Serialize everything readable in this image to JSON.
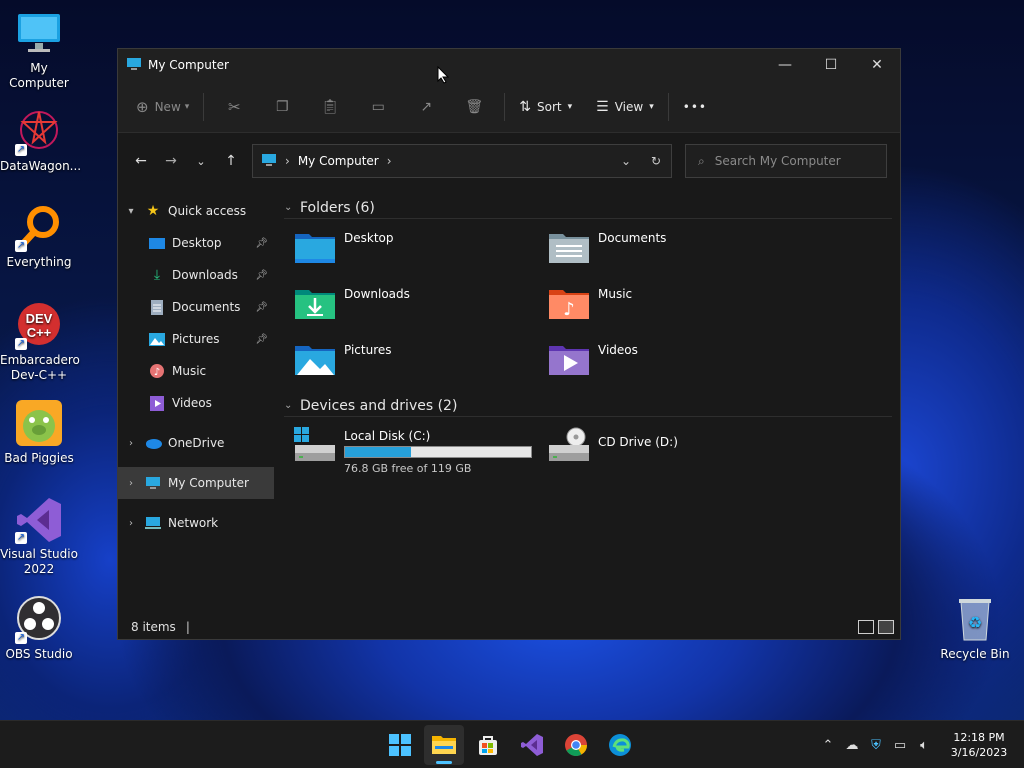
{
  "desktop": {
    "icons": [
      {
        "label": "My Computer"
      },
      {
        "label": "DataWagon..."
      },
      {
        "label": "Everything"
      },
      {
        "label": "Embarcadero Dev-C++"
      },
      {
        "label": "Bad Piggies"
      },
      {
        "label": "Visual Studio 2022"
      },
      {
        "label": "OBS Studio"
      }
    ],
    "recycle_bin": {
      "label": "Recycle Bin"
    }
  },
  "window": {
    "title": "My Computer",
    "toolbar": {
      "new_label": "New",
      "sort_label": "Sort",
      "view_label": "View",
      "more_label": "•••"
    },
    "address": {
      "path_label": "My Computer",
      "search_placeholder": "Search My Computer"
    },
    "nav": {
      "quick_access": "Quick access",
      "items": [
        {
          "label": "Desktop"
        },
        {
          "label": "Downloads"
        },
        {
          "label": "Documents"
        },
        {
          "label": "Pictures"
        },
        {
          "label": "Music"
        },
        {
          "label": "Videos"
        }
      ],
      "onedrive": "OneDrive",
      "my_computer": "My Computer",
      "network": "Network"
    },
    "folders": {
      "heading": "Folders (6)",
      "items": [
        {
          "label": "Desktop",
          "icon": "desktop-folder-icon"
        },
        {
          "label": "Documents",
          "icon": "documents-folder-icon"
        },
        {
          "label": "Downloads",
          "icon": "downloads-folder-icon"
        },
        {
          "label": "Music",
          "icon": "music-folder-icon"
        },
        {
          "label": "Pictures",
          "icon": "pictures-folder-icon"
        },
        {
          "label": "Videos",
          "icon": "videos-folder-icon"
        }
      ]
    },
    "drives": {
      "heading": "Devices and drives (2)",
      "local": {
        "label": "Local Disk (C:)",
        "free_text": "76.8 GB free of 119 GB",
        "used_fraction": 0.355
      },
      "cd": {
        "label": "CD Drive (D:)"
      }
    },
    "status": {
      "items_count": "8 items"
    }
  },
  "taskbar": {
    "time": "12:18 PM",
    "date": "3/16/2023"
  },
  "colors": {
    "accent": "#4cc2ff",
    "drive_fill": "#26a0da",
    "window_bg": "#191919"
  }
}
